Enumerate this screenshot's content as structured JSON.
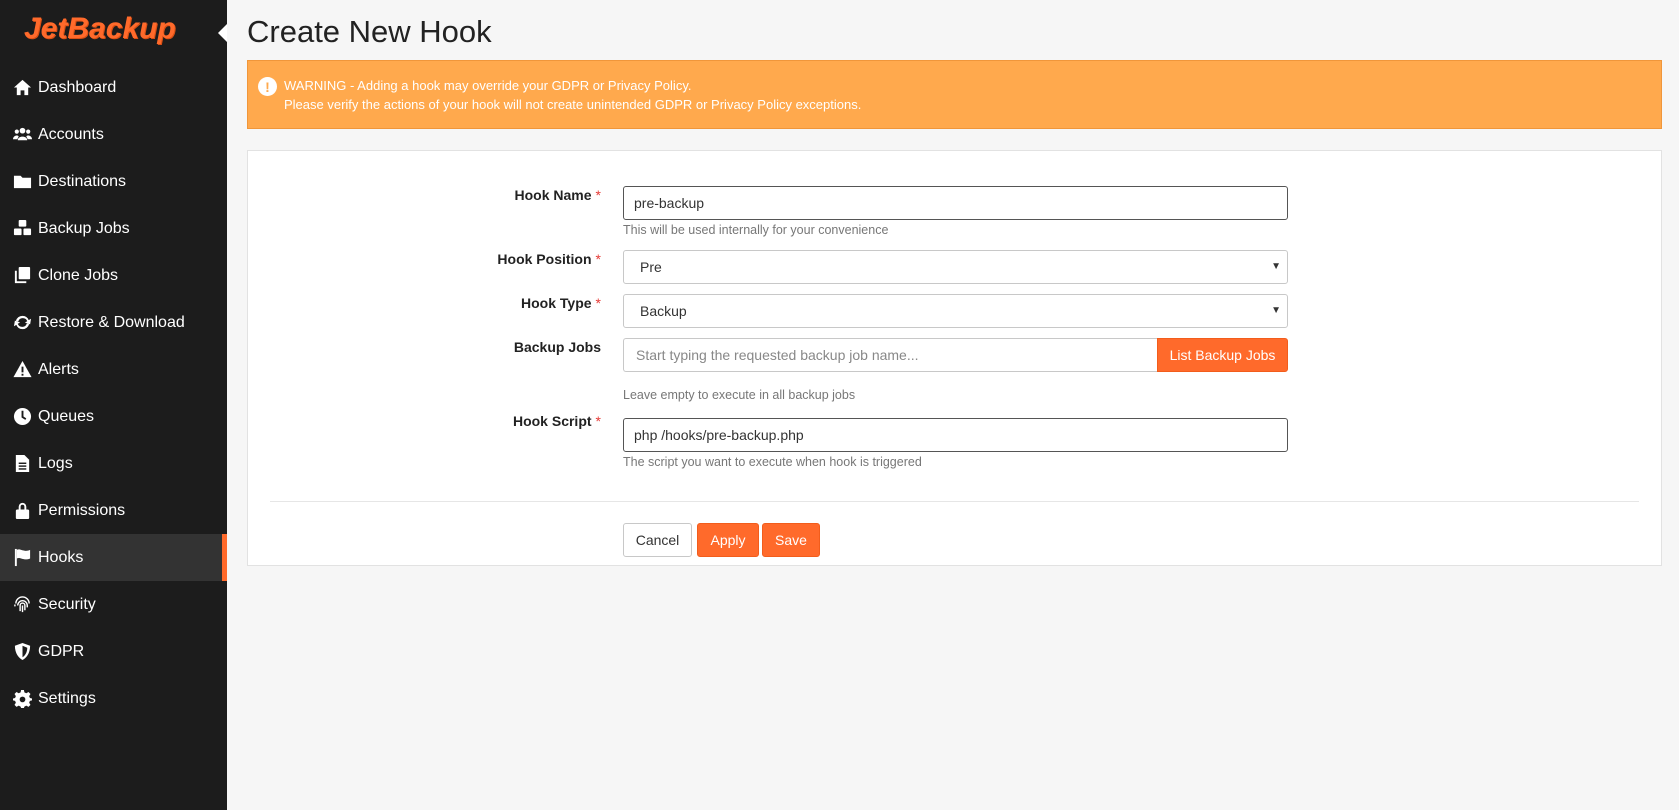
{
  "brand": {
    "logo_text": "JetBackup",
    "accent_color": "#ff6a2b"
  },
  "sidebar": {
    "items": [
      {
        "label": "Dashboard",
        "icon": "home-icon",
        "active": false
      },
      {
        "label": "Accounts",
        "icon": "users-icon",
        "active": false
      },
      {
        "label": "Destinations",
        "icon": "folder-icon",
        "active": false
      },
      {
        "label": "Backup Jobs",
        "icon": "cubes-icon",
        "active": false
      },
      {
        "label": "Clone Jobs",
        "icon": "clone-icon",
        "active": false
      },
      {
        "label": "Restore & Download",
        "icon": "sync-icon",
        "active": false
      },
      {
        "label": "Alerts",
        "icon": "warning-icon",
        "active": false
      },
      {
        "label": "Queues",
        "icon": "clock-icon",
        "active": false
      },
      {
        "label": "Logs",
        "icon": "file-icon",
        "active": false
      },
      {
        "label": "Permissions",
        "icon": "lock-icon",
        "active": false
      },
      {
        "label": "Hooks",
        "icon": "flag-icon",
        "active": true
      },
      {
        "label": "Security",
        "icon": "fingerprint-icon",
        "active": false
      },
      {
        "label": "GDPR",
        "icon": "shield-icon",
        "active": false
      },
      {
        "label": "Settings",
        "icon": "gear-icon",
        "active": false
      }
    ]
  },
  "page": {
    "title": "Create New Hook"
  },
  "alert": {
    "icon": "exclamation-icon",
    "line1": "WARNING - Adding a hook may override your GDPR or Privacy Policy.",
    "line2": "Please verify the actions of your hook will not create unintended GDPR or Privacy Policy exceptions."
  },
  "form": {
    "required_mark": "*",
    "hook_name": {
      "label": "Hook Name",
      "value": "pre-backup",
      "help": "This will be used internally for your convenience"
    },
    "hook_position": {
      "label": "Hook Position",
      "value": "Pre"
    },
    "hook_type": {
      "label": "Hook Type",
      "value": "Backup"
    },
    "backup_jobs": {
      "label": "Backup Jobs",
      "placeholder": "Start typing the requested backup job name...",
      "button": "List Backup Jobs",
      "help": "Leave empty to execute in all backup jobs"
    },
    "hook_script": {
      "label": "Hook Script",
      "value": "php /hooks/pre-backup.php",
      "help": "The script you want to execute when hook is triggered"
    }
  },
  "actions": {
    "cancel": "Cancel",
    "apply": "Apply",
    "save": "Save"
  }
}
